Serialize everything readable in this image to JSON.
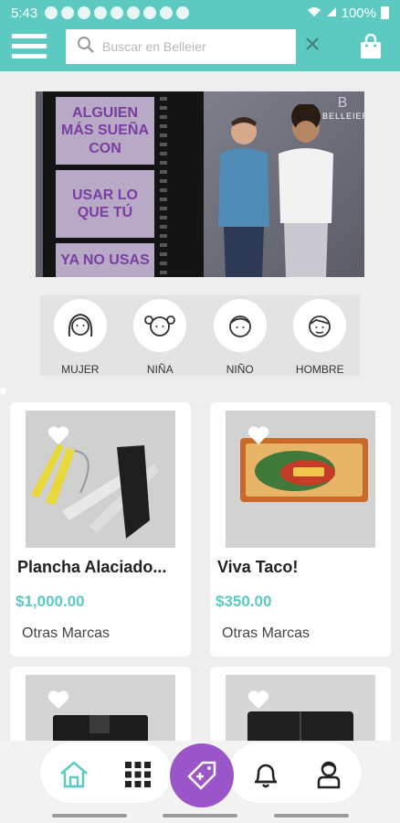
{
  "status_bar": {
    "time": "5:43",
    "battery": "100%"
  },
  "app_bar": {
    "search_placeholder": "Buscar en Belleier",
    "icons": [
      "menu-icon",
      "search-icon",
      "close-icon",
      "shopping-bag-icon"
    ]
  },
  "banner": {
    "frames": [
      "ALGUIEN MÁS SUEÑA CON",
      "USAR LO QUE TÚ",
      "YA NO USAS"
    ],
    "brand_letter": "B",
    "brand_name": "BELLEIER"
  },
  "categories": [
    {
      "label": "MUJER",
      "icon": "woman-face-icon"
    },
    {
      "label": "NIÑA",
      "icon": "girl-face-icon"
    },
    {
      "label": "NIÑO",
      "icon": "boy-face-icon"
    },
    {
      "label": "HOMBRE",
      "icon": "man-face-icon"
    }
  ],
  "products": [
    {
      "title": "Plancha Alaciado...",
      "price": "$1,000.00",
      "brand": "Otras Marcas"
    },
    {
      "title": "Viva Taco!",
      "price": "$350.00",
      "brand": "Otras Marcas"
    },
    {
      "title": "",
      "price": "",
      "brand": ""
    },
    {
      "title": "",
      "price": "",
      "brand": ""
    }
  ],
  "colors": {
    "accent": "#5ccac1",
    "sell_button": "#9a55c9",
    "banner_text": "#7a3ea0"
  },
  "bottom_nav": [
    "home-icon",
    "grid-icon",
    "sell-tag-icon",
    "bell-icon",
    "profile-icon"
  ]
}
